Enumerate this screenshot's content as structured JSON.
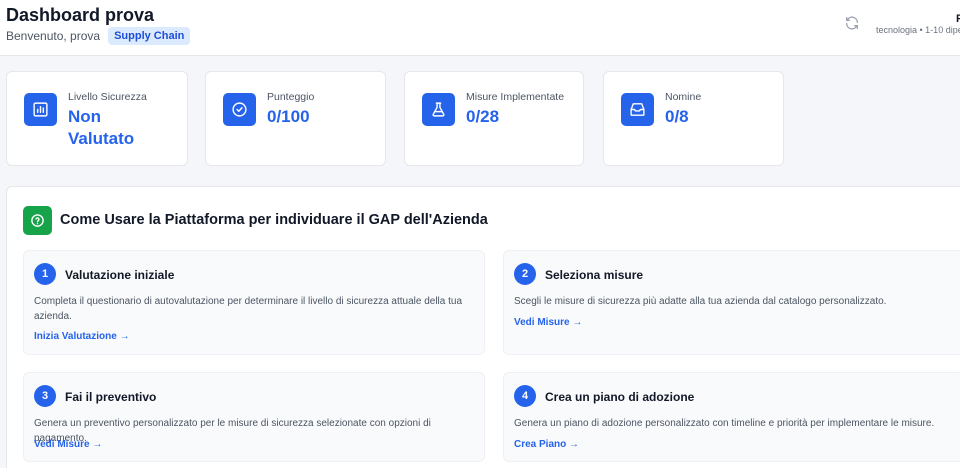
{
  "header": {
    "title": "Dashboard prova",
    "welcome": "Benvenuto, prova",
    "badge": "Supply Chain",
    "company_meta": "tecnologia • 1-10 dipe",
    "user_initial": "P"
  },
  "stats": [
    {
      "label": "Livello Sicurezza",
      "value": "Non Valutato",
      "icon": "bar-chart-icon"
    },
    {
      "label": "Punteggio",
      "value": "0/100",
      "icon": "check-circle-icon"
    },
    {
      "label": "Misure Implementate",
      "value": "0/28",
      "icon": "flask-icon"
    },
    {
      "label": "Nomine",
      "value": "0/8",
      "icon": "inbox-icon"
    }
  ],
  "guide": {
    "title": "Come Usare la Piattaforma per individuare il GAP dell'Azienda",
    "icon": "help-circle-icon",
    "steps": [
      {
        "number": "1",
        "title": "Valutazione iniziale",
        "description": "Completa il questionario di autovalutazione per determinare il livello di sicurezza attuale della tua azienda.",
        "link": "Inizia Valutazione →"
      },
      {
        "number": "2",
        "title": "Seleziona misure",
        "description": "Scegli le misure di sicurezza più adatte alla tua azienda dal catalogo personalizzato.",
        "link": "Vedi Misure →"
      },
      {
        "number": "3",
        "title": "Fai il preventivo",
        "description": "Genera un preventivo personalizzato per le misure di sicurezza selezionate con opzioni di pagamento.",
        "link": "Vedi Misure →"
      },
      {
        "number": "4",
        "title": "Crea un piano di adozione",
        "description": "Genera un piano di adozione personalizzato con timeline e priorità per implementare le misure.",
        "link": "Crea Piano →"
      }
    ]
  },
  "colors": {
    "accent": "#2563eb",
    "success": "#16a34a",
    "badge_bg": "#dbeafe"
  }
}
